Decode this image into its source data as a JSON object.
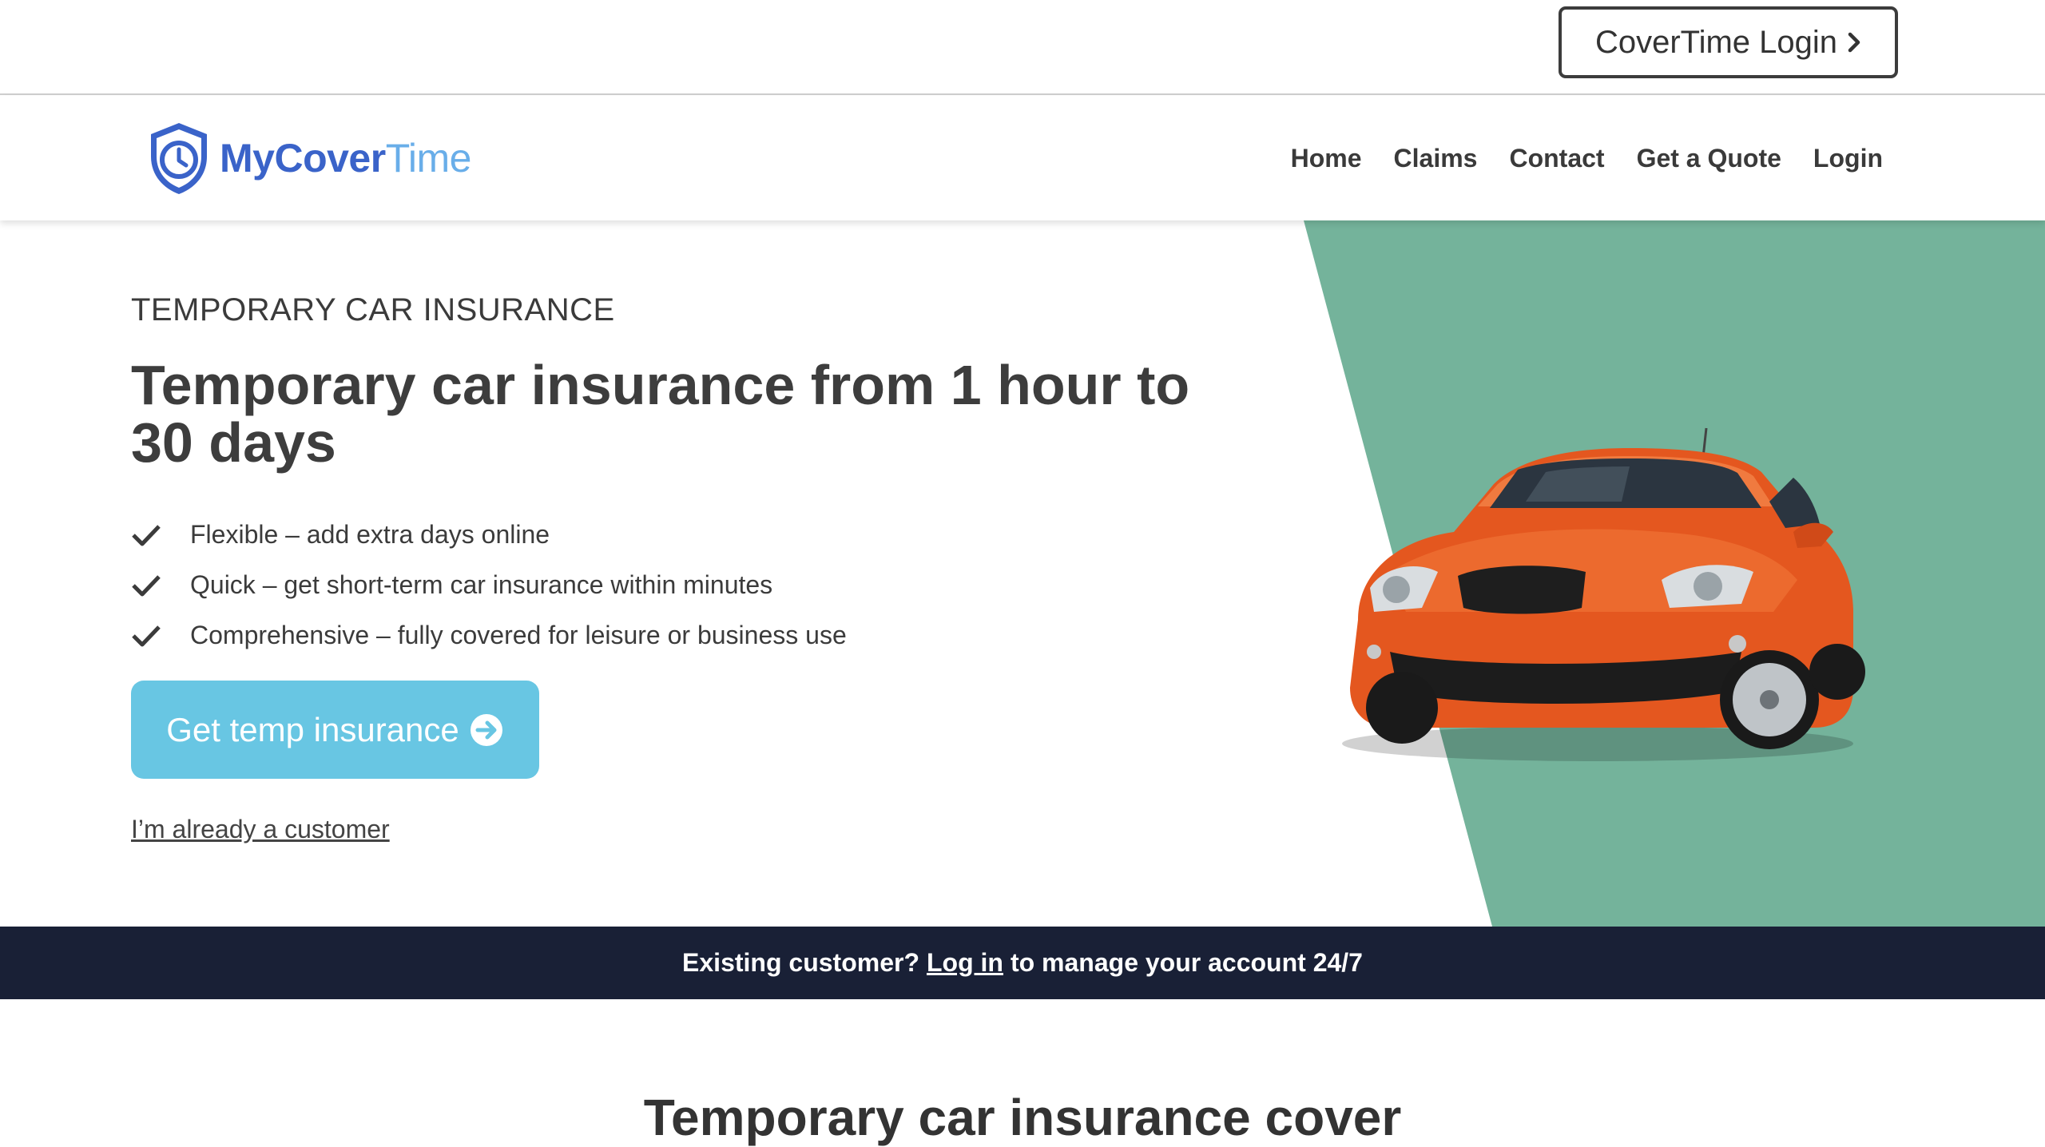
{
  "topbar": {
    "login_label": "CoverTime Login"
  },
  "brand": {
    "part1": "My",
    "part2": "Cover",
    "part3": "Time"
  },
  "nav": {
    "items": [
      "Home",
      "Claims",
      "Contact",
      "Get a Quote",
      "Login"
    ]
  },
  "hero": {
    "eyebrow": "TEMPORARY CAR INSURANCE",
    "title": "Temporary car insurance from 1 hour to 30 days",
    "features": [
      "Flexible – add extra days online",
      "Quick – get short-term car insurance within minutes",
      "Comprehensive – fully covered for leisure or business use"
    ],
    "cta_label": "Get temp insurance",
    "secondary_link": "I’m already a customer"
  },
  "banner": {
    "prefix": "Existing customer?",
    "link": "Log in",
    "suffix": "to manage your account 24/7"
  },
  "section": {
    "title": "Temporary car insurance cover"
  },
  "colors": {
    "brand_blue": "#3a63c9",
    "brand_light_blue": "#69aee9",
    "hero_green": "#74b39b",
    "cta_blue": "#68c6e3",
    "banner_navy": "#192036",
    "car_orange": "#e4571f"
  }
}
